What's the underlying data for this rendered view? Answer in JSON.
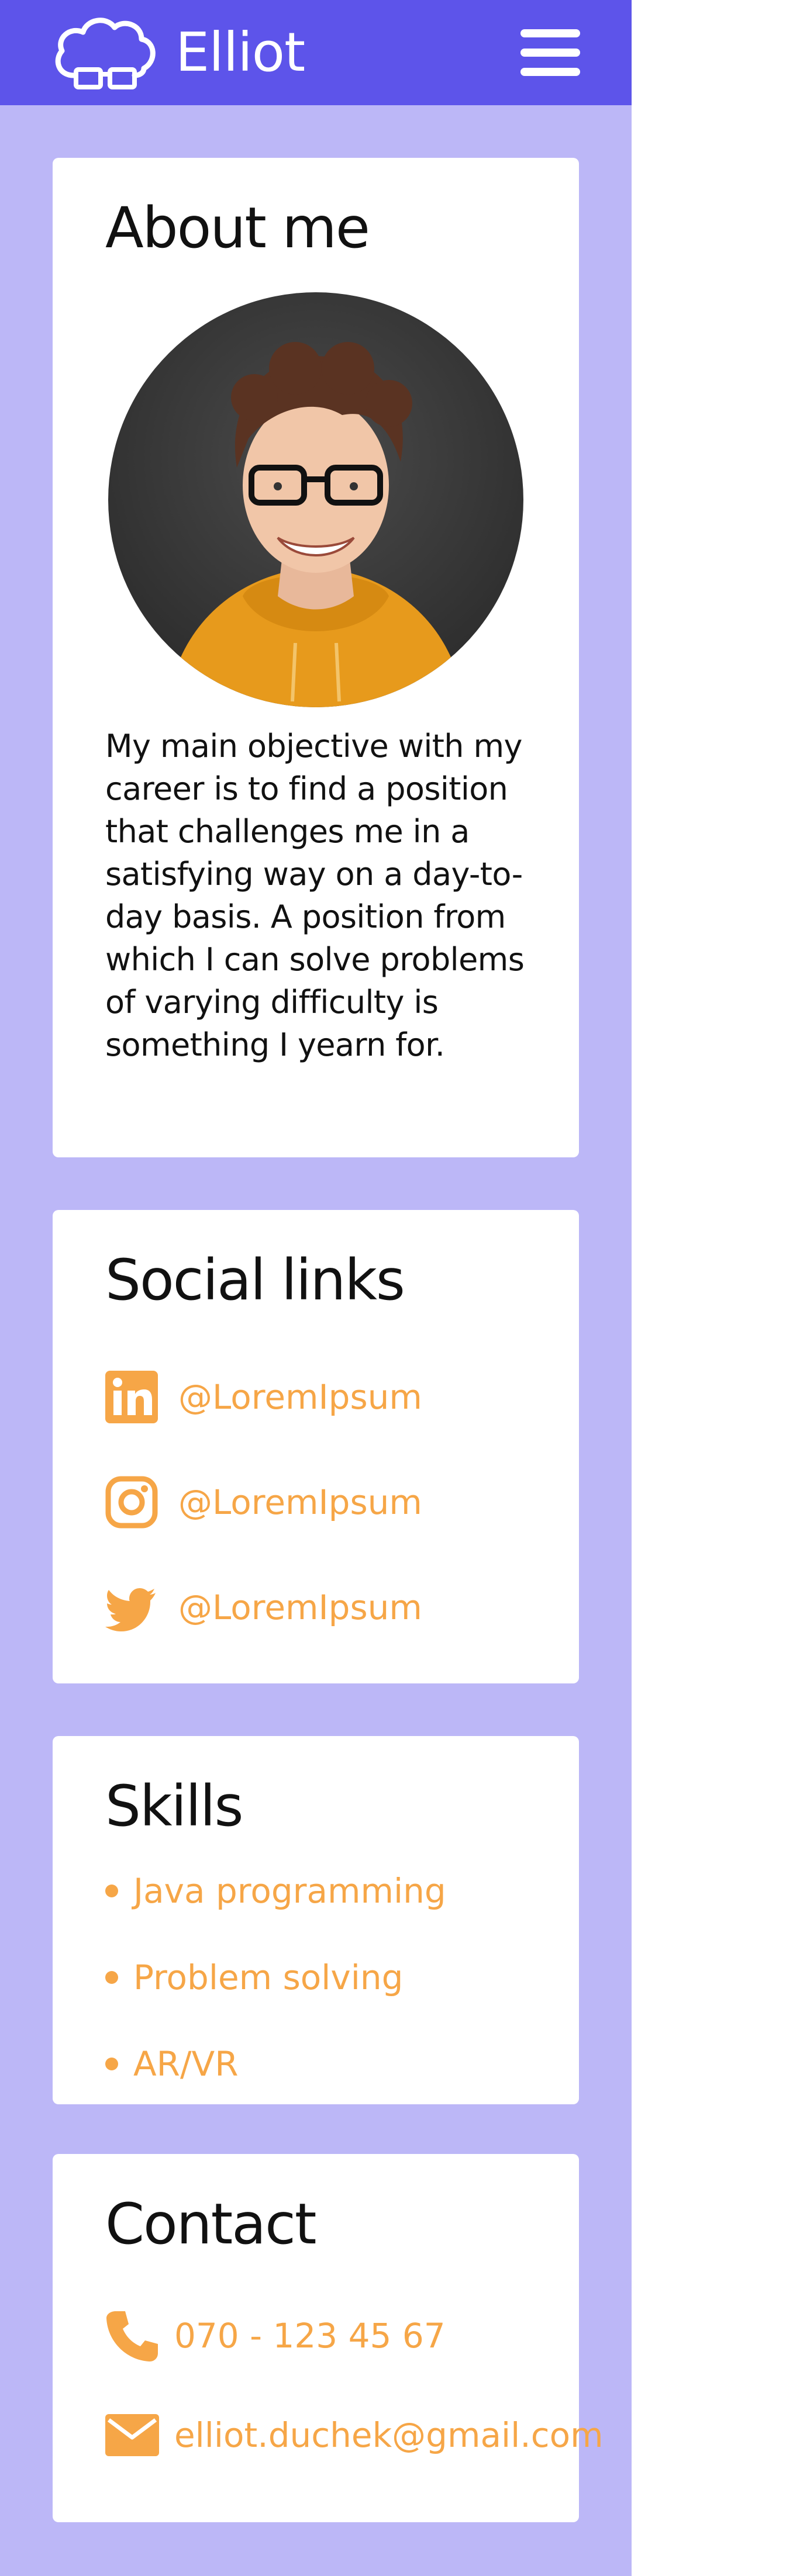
{
  "header": {
    "brand": "Elliot",
    "logo_icon": "cloud-with-glasses-icon",
    "menu_icon": "hamburger-menu-icon",
    "background_color": "#5d54ea"
  },
  "theme": {
    "page_background": "#bcb7f7",
    "accent": "#f6a647",
    "card_background": "#ffffff"
  },
  "about": {
    "title": "About me",
    "photo_alt": "Portrait of Elliot",
    "text": "My main objective with my career is to find a po­sition that challenges me in a satisfying way on a day-to-day basis. A posi­tion from which I can solve problems of varying difficulty is something I yearn for."
  },
  "social": {
    "title": "Social links",
    "links": [
      {
        "icon": "linkedin-icon",
        "handle": "@LoremIpsum"
      },
      {
        "icon": "instagram-icon",
        "handle": "@LoremIpsum"
      },
      {
        "icon": "twitter-icon",
        "handle": "@LoremIpsum"
      }
    ]
  },
  "skills": {
    "title": "Skills",
    "items": [
      "Java programming",
      "Problem solving",
      "AR/VR"
    ]
  },
  "contact": {
    "title": "Contact",
    "phone": {
      "icon": "phone-icon",
      "value": "070 - 123 45 67"
    },
    "email": {
      "icon": "mail-icon",
      "value": "elliot.duchek@gmail.com"
    }
  }
}
